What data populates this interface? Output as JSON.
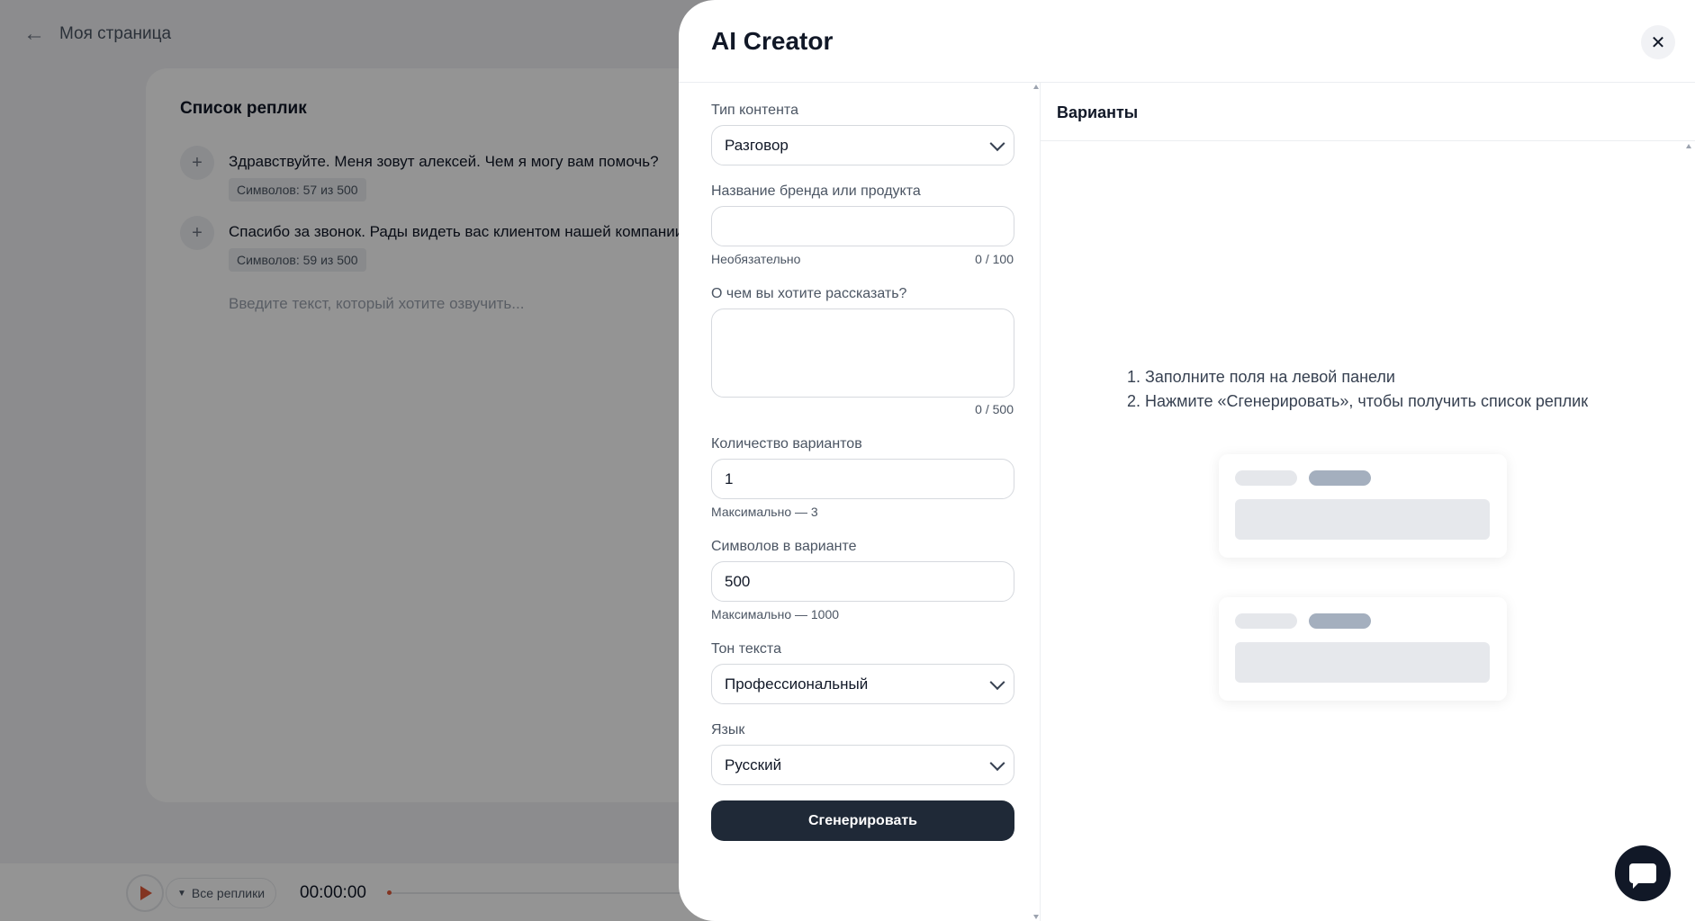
{
  "background": {
    "page_name": "Моя страница",
    "list_title": "Список реплик",
    "replies": [
      {
        "text": "Здравствуйте. Меня зовут алексей. Чем я могу вам помочь?",
        "count": "Символов: 57 из 500"
      },
      {
        "text": "Спасибо за звонок. Рады видеть вас клиентом нашей компании.",
        "count": "Символов: 59 из 500"
      }
    ],
    "placeholder": "Введите текст, который хотите озвучить...",
    "player": {
      "all_replies": "Все реплики",
      "time": "00:00:00"
    }
  },
  "drawer": {
    "title": "AI Creator",
    "form": {
      "content_type": {
        "label": "Тип контента",
        "value": "Разговор"
      },
      "brand": {
        "label": "Название бренда или продукта",
        "value": "",
        "hint": "Необязательно",
        "counter": "0 / 100"
      },
      "about": {
        "label": "О чем вы хотите рассказать?",
        "value": "",
        "counter": "0 / 500"
      },
      "variants_count": {
        "label": "Количество вариантов",
        "value": "1",
        "hint": "Максимально — 3"
      },
      "chars": {
        "label": "Символов в варианте",
        "value": "500",
        "hint": "Максимально — 1000"
      },
      "tone": {
        "label": "Тон текста",
        "value": "Профессиональный"
      },
      "language": {
        "label": "Язык",
        "value": "Русский"
      },
      "generate_label": "Сгенерировать"
    },
    "variants": {
      "title": "Варианты",
      "steps": [
        "1. Заполните поля на левой панели",
        "2. Нажмите «Сгенерировать», чтобы получить список реплик"
      ]
    }
  },
  "colors": {
    "primary_button": "#1f2937",
    "accent_red": "#e25a3a",
    "overlay": "rgba(0,0,0,0.42)"
  }
}
